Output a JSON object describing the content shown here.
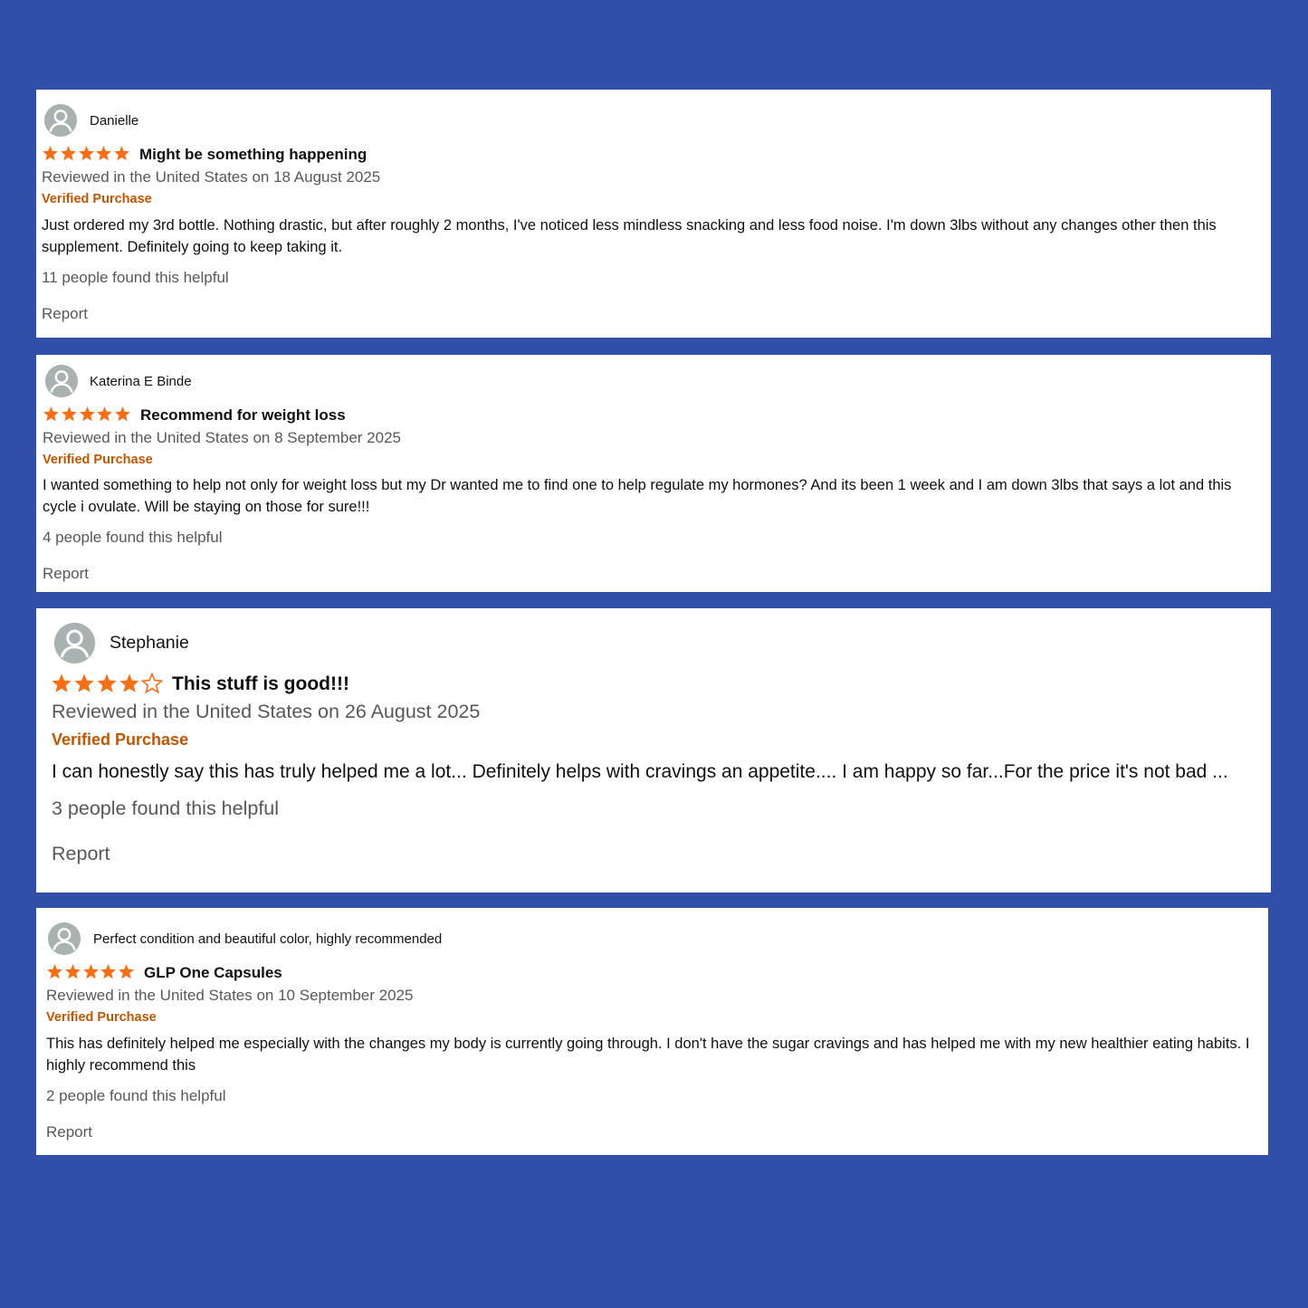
{
  "colors": {
    "background": "#304fa8",
    "card": "#ffffff",
    "star": "#f96d13",
    "verified": "#c45500",
    "meta": "#565959",
    "avatar": "#a8b3b1"
  },
  "icons": {
    "avatar": "user-avatar-icon",
    "star": "star-icon"
  },
  "reviews": [
    {
      "reviewer": "Danielle",
      "rating": 5,
      "title": "Might be something happening",
      "meta": "Reviewed in the United States on 18 August 2025",
      "verified": "Verified Purchase",
      "body": "Just ordered my 3rd bottle. Nothing drastic, but after roughly 2 months, I've noticed less mindless snacking and less food noise. I'm down 3lbs without any changes other then this supplement. Definitely going to keep taking it.",
      "helpful": "11 people found this helpful",
      "report": "Report"
    },
    {
      "reviewer": "Katerina E Binde",
      "rating": 5,
      "title": "Recommend for weight loss",
      "meta": "Reviewed in the United States on 8 September 2025",
      "verified": "Verified Purchase",
      "body": "I wanted something to help not only for weight loss but my Dr wanted me to find one to help regulate my hormones? And its been 1 week and I am down 3lbs that says a lot and this cycle i ovulate. Will be staying on those for sure!!!",
      "helpful": "4 people found this helpful",
      "report": "Report"
    },
    {
      "reviewer": "Stephanie",
      "rating": 4,
      "title": "This stuff is good!!!",
      "meta": "Reviewed in the United States on 26 August 2025",
      "verified": "Verified Purchase",
      "body": "I can honestly say this has truly helped me a lot... Definitely helps with cravings an appetite.... I am happy so far...For the price it's not bad ...",
      "helpful": "3 people found this helpful",
      "report": "Report"
    },
    {
      "reviewer": "Perfect condition and beautiful color, highly recommended",
      "rating": 5,
      "title": "GLP One Capsules",
      "meta": "Reviewed in the United States on 10 September 2025",
      "verified": "Verified Purchase",
      "body": "This has definitely helped me especially with the changes my body is currently going through. I don't have the sugar cravings and has helped me with my new healthier eating habits. I highly recommend this",
      "helpful": "2 people found this helpful",
      "report": "Report"
    }
  ]
}
